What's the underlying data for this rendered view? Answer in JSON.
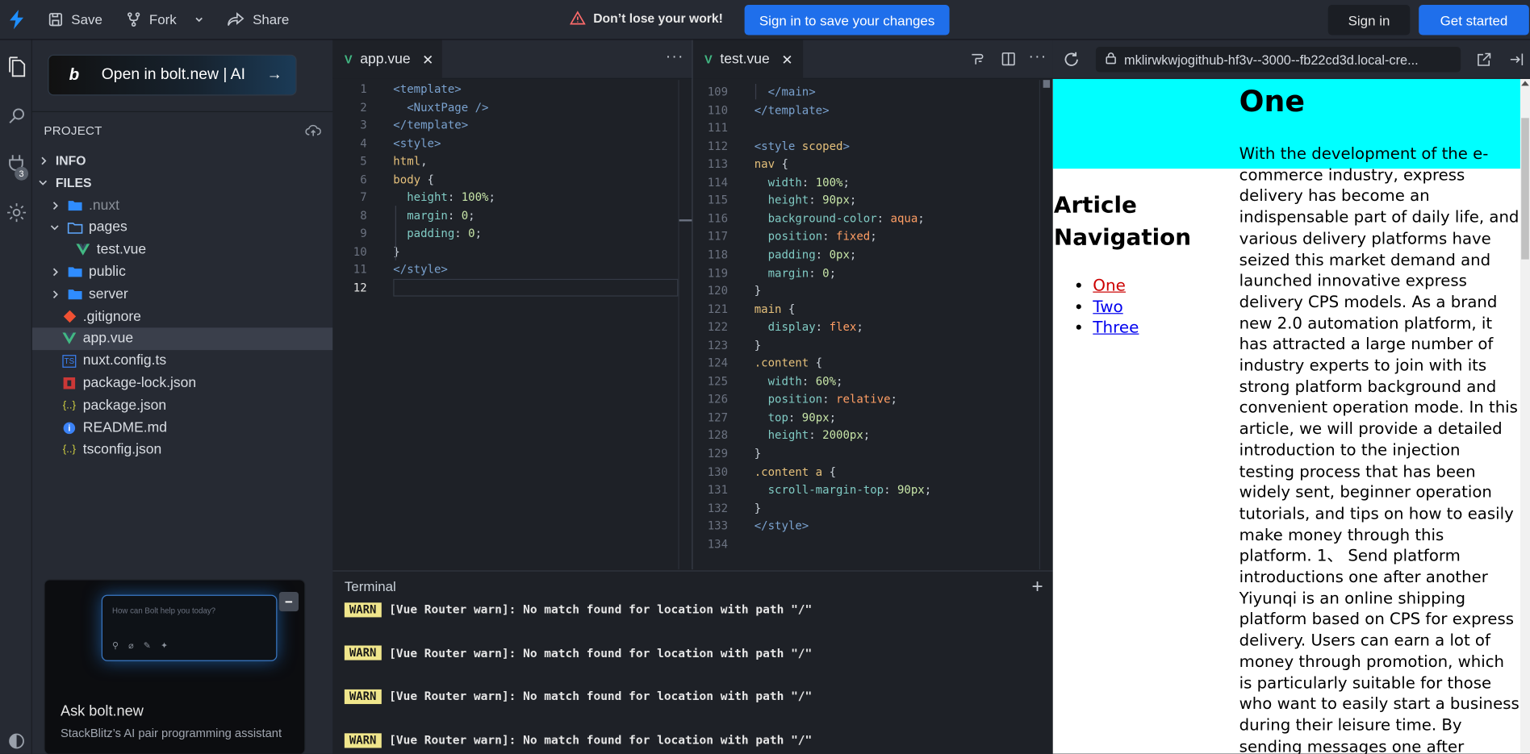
{
  "topbar": {
    "save": "Save",
    "fork": "Fork",
    "share": "Share",
    "warning": "Don’t lose your work!",
    "signin_save": "Sign in to save your changes",
    "signin": "Sign in",
    "get_started": "Get started"
  },
  "activity": {
    "badge": "3"
  },
  "sidebar": {
    "open_bolt": "Open in bolt.new | AI",
    "project_header": "PROJECT",
    "sections": [
      {
        "label": "INFO"
      },
      {
        "label": "FILES"
      }
    ],
    "files": [
      {
        "label": ".nuxt",
        "icon": "folder-icon",
        "kind": "folder",
        "dimmed": true
      },
      {
        "label": "pages",
        "icon": "folder-open-icon",
        "kind": "folder-open"
      },
      {
        "label": "test.vue",
        "icon": "vue-file-icon",
        "kind": "vue"
      },
      {
        "label": "public",
        "icon": "folder-icon",
        "kind": "folder"
      },
      {
        "label": "server",
        "icon": "folder-icon",
        "kind": "folder"
      },
      {
        "label": ".gitignore",
        "icon": "git-icon",
        "kind": "git"
      },
      {
        "label": "app.vue",
        "icon": "vue-file-icon",
        "kind": "vue",
        "selected": true
      },
      {
        "label": "nuxt.config.ts",
        "icon": "typescript-icon",
        "kind": "ts"
      },
      {
        "label": "package-lock.json",
        "icon": "npm-icon",
        "kind": "npm"
      },
      {
        "label": "package.json",
        "icon": "json-icon",
        "kind": "json"
      },
      {
        "label": "README.md",
        "icon": "info-icon",
        "kind": "info"
      },
      {
        "label": "tsconfig.json",
        "icon": "json-icon",
        "kind": "json"
      }
    ],
    "ask": {
      "placeholder": "How can Bolt help you today?",
      "title": "Ask bolt.new",
      "subtitle": "StackBlitz’s AI pair programming assistant"
    }
  },
  "editor_left": {
    "tab": "app.vue",
    "cursor_line": 12,
    "lines": [
      {
        "n": "1",
        "tokens": [
          [
            "tag",
            "<template>"
          ]
        ]
      },
      {
        "n": "2",
        "tokens": [
          [
            "pun",
            "  "
          ],
          [
            "tag",
            "<NuxtPage />"
          ]
        ]
      },
      {
        "n": "3",
        "tokens": [
          [
            "tag",
            "</template>"
          ]
        ]
      },
      {
        "n": "4",
        "tokens": [
          [
            "tag",
            "<style>"
          ]
        ]
      },
      {
        "n": "5",
        "tokens": [
          [
            "sel2",
            "html"
          ],
          [
            "pun",
            ","
          ]
        ]
      },
      {
        "n": "6",
        "tokens": [
          [
            "sel2",
            "body"
          ],
          [
            "pun",
            " {"
          ]
        ]
      },
      {
        "n": "7",
        "tokens": [
          [
            "prop",
            "  height"
          ],
          [
            "pun",
            ": "
          ],
          [
            "val",
            "100%"
          ],
          [
            "pun",
            ";"
          ]
        ]
      },
      {
        "n": "8",
        "tokens": [
          [
            "prop",
            "  margin"
          ],
          [
            "pun",
            ": "
          ],
          [
            "val",
            "0"
          ],
          [
            "pun",
            ";"
          ]
        ]
      },
      {
        "n": "9",
        "tokens": [
          [
            "prop",
            "  padding"
          ],
          [
            "pun",
            ": "
          ],
          [
            "val",
            "0"
          ],
          [
            "pun",
            ";"
          ]
        ]
      },
      {
        "n": "10",
        "tokens": [
          [
            "pun",
            "}"
          ]
        ]
      },
      {
        "n": "11",
        "tokens": [
          [
            "tag",
            "</style>"
          ]
        ]
      },
      {
        "n": "12",
        "tokens": []
      }
    ]
  },
  "editor_right": {
    "tab": "test.vue",
    "lines": [
      {
        "n": "109",
        "tokens": [
          [
            "pun",
            "  "
          ],
          [
            "tag",
            "</main>"
          ]
        ]
      },
      {
        "n": "110",
        "tokens": [
          [
            "tag",
            "</template>"
          ]
        ]
      },
      {
        "n": "111",
        "tokens": []
      },
      {
        "n": "112",
        "tokens": [
          [
            "tag",
            "<style "
          ],
          [
            "sel2",
            "scoped"
          ],
          [
            "tag",
            ">"
          ]
        ]
      },
      {
        "n": "113",
        "tokens": [
          [
            "sel2",
            "nav"
          ],
          [
            "pun",
            " {"
          ]
        ]
      },
      {
        "n": "114",
        "tokens": [
          [
            "prop",
            "  width"
          ],
          [
            "pun",
            ": "
          ],
          [
            "val",
            "100%"
          ],
          [
            "pun",
            ";"
          ]
        ]
      },
      {
        "n": "115",
        "tokens": [
          [
            "prop",
            "  height"
          ],
          [
            "pun",
            ": "
          ],
          [
            "val",
            "90px"
          ],
          [
            "pun",
            ";"
          ]
        ]
      },
      {
        "n": "116",
        "tokens": [
          [
            "prop",
            "  background-color"
          ],
          [
            "pun",
            ": "
          ],
          [
            "val2",
            "aqua"
          ],
          [
            "pun",
            ";"
          ]
        ]
      },
      {
        "n": "117",
        "tokens": [
          [
            "prop",
            "  position"
          ],
          [
            "pun",
            ": "
          ],
          [
            "val2",
            "fixed"
          ],
          [
            "pun",
            ";"
          ]
        ]
      },
      {
        "n": "118",
        "tokens": [
          [
            "prop",
            "  padding"
          ],
          [
            "pun",
            ": "
          ],
          [
            "val",
            "0px"
          ],
          [
            "pun",
            ";"
          ]
        ]
      },
      {
        "n": "119",
        "tokens": [
          [
            "prop",
            "  margin"
          ],
          [
            "pun",
            ": "
          ],
          [
            "val",
            "0"
          ],
          [
            "pun",
            ";"
          ]
        ]
      },
      {
        "n": "120",
        "tokens": [
          [
            "pun",
            "}"
          ]
        ]
      },
      {
        "n": "121",
        "tokens": [
          [
            "sel2",
            "main"
          ],
          [
            "pun",
            " {"
          ]
        ]
      },
      {
        "n": "122",
        "tokens": [
          [
            "prop",
            "  display"
          ],
          [
            "pun",
            ": "
          ],
          [
            "val2",
            "flex"
          ],
          [
            "pun",
            ";"
          ]
        ]
      },
      {
        "n": "123",
        "tokens": [
          [
            "pun",
            "}"
          ]
        ]
      },
      {
        "n": "124",
        "tokens": [
          [
            "sel2",
            ".content"
          ],
          [
            "pun",
            " {"
          ]
        ]
      },
      {
        "n": "125",
        "tokens": [
          [
            "prop",
            "  width"
          ],
          [
            "pun",
            ": "
          ],
          [
            "val",
            "60%"
          ],
          [
            "pun",
            ";"
          ]
        ]
      },
      {
        "n": "126",
        "tokens": [
          [
            "prop",
            "  position"
          ],
          [
            "pun",
            ": "
          ],
          [
            "val2",
            "relative"
          ],
          [
            "pun",
            ";"
          ]
        ]
      },
      {
        "n": "127",
        "tokens": [
          [
            "prop",
            "  top"
          ],
          [
            "pun",
            ": "
          ],
          [
            "val",
            "90px"
          ],
          [
            "pun",
            ";"
          ]
        ]
      },
      {
        "n": "128",
        "tokens": [
          [
            "prop",
            "  height"
          ],
          [
            "pun",
            ": "
          ],
          [
            "val",
            "2000px"
          ],
          [
            "pun",
            ";"
          ]
        ]
      },
      {
        "n": "129",
        "tokens": [
          [
            "pun",
            "}"
          ]
        ]
      },
      {
        "n": "130",
        "tokens": [
          [
            "sel2",
            ".content a"
          ],
          [
            "pun",
            " {"
          ]
        ]
      },
      {
        "n": "131",
        "tokens": [
          [
            "prop",
            "  scroll-margin-top"
          ],
          [
            "pun",
            ": "
          ],
          [
            "val",
            "90px"
          ],
          [
            "pun",
            ";"
          ]
        ]
      },
      {
        "n": "132",
        "tokens": [
          [
            "pun",
            "}"
          ]
        ]
      },
      {
        "n": "133",
        "tokens": [
          [
            "tag",
            "</style>"
          ]
        ]
      },
      {
        "n": "134",
        "tokens": []
      }
    ]
  },
  "terminal": {
    "title": "Terminal",
    "lines": [
      {
        "badge": "WARN",
        "text": "[Vue Router warn]: No match found for location with path \"/\""
      },
      {
        "badge": "WARN",
        "text": "[Vue Router warn]: No match found for location with path \"/\""
      },
      {
        "badge": "WARN",
        "text": "[Vue Router warn]: No match found for location with path \"/\""
      },
      {
        "badge": "WARN",
        "text": "[Vue Router warn]: No match found for location with path \"/\""
      }
    ]
  },
  "preview": {
    "url": "mklirwkwjogithub-hf3v--3000--fb22cd3d.local-cre...",
    "heading": "One",
    "nav_heading": "Article Navigation",
    "links": [
      {
        "label": "One",
        "visited": true
      },
      {
        "label": "Two",
        "visited": false
      },
      {
        "label": "Three",
        "visited": false
      }
    ],
    "body_text": "With the development of the e-commerce industry, express delivery has become an indispensable part of daily life, and various delivery platforms have seized this market demand and launched innovative express delivery CPS models. As a brand new 2.0 automation platform, it has attracted a large number of industry experts to join with its strong platform background and convenient operation mode. In this article, we will provide a detailed introduction to the injection testing process that has been widely sent, beginner operation tutorials, and tips on how to easily make money through this platform. 1、 Send platform introductions one after another Yiyunqi is an online shipping platform based on CPS for express delivery. Users can earn a lot of money through promotion, which is particularly suitable for those who want to easily start a business during their leisure time. By sending messages one after another, users do not need to"
  },
  "colors": {
    "accent": "#1f6feb",
    "nav_bg": "#00ffff",
    "warn_badge": "#f0e68c",
    "visited_link": "#cc0000",
    "link": "#0000ee"
  }
}
